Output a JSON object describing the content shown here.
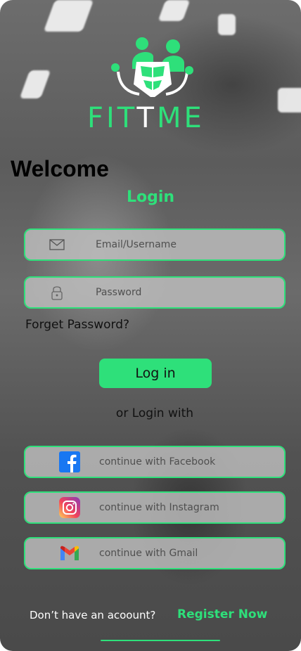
{
  "brand": {
    "name_green_1": "FIT",
    "name_white": "T",
    "name_green_2": "ME"
  },
  "welcome": "Welcome",
  "login_title": "Login",
  "fields": {
    "email_placeholder": "Email/Username",
    "password_placeholder": "Password"
  },
  "forgot_password": "Forget Password?",
  "login_button": "Log in",
  "or_login_with": "or Login with",
  "social": {
    "facebook": "continue with Facebook",
    "instagram": "continue with Instagram",
    "gmail": "continue with Gmail"
  },
  "footer": {
    "no_account": "Don’t have an acoount?",
    "register": "Register Now"
  },
  "colors": {
    "accent": "#2ee07a",
    "field_bg": "#bebebe"
  },
  "icons": [
    "mail-icon",
    "lock-icon",
    "facebook-icon",
    "instagram-icon",
    "gmail-icon"
  ]
}
